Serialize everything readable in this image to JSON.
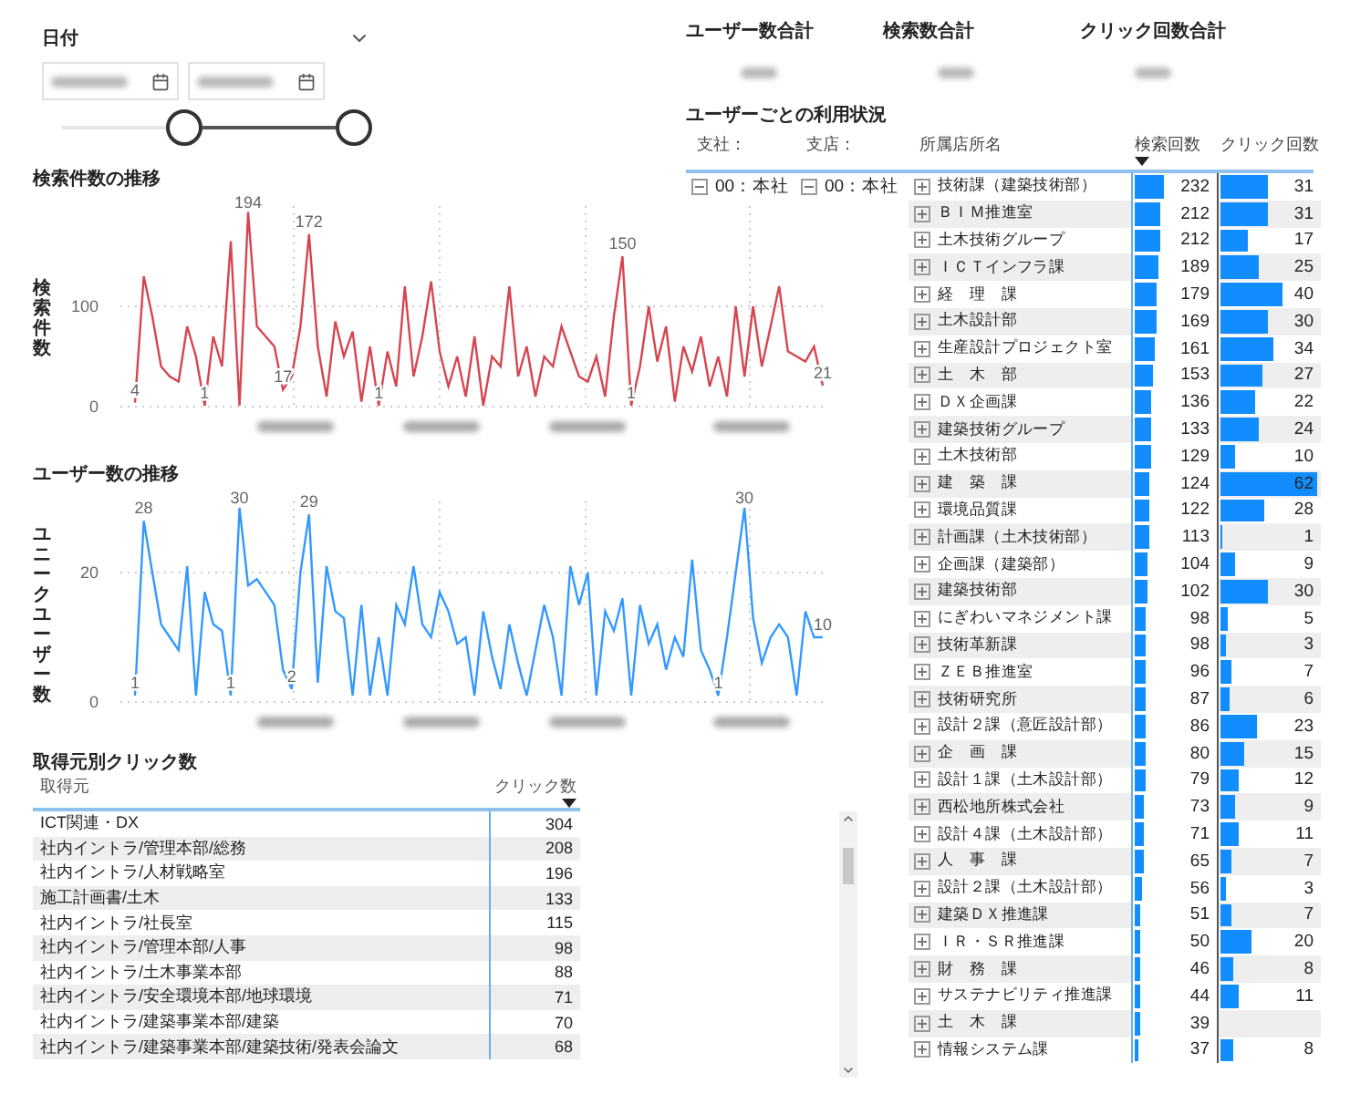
{
  "date_slicer": {
    "title": "日付",
    "handles": [
      {
        "level": 0.42
      },
      {
        "level": 1
      }
    ]
  },
  "search_chart": {
    "title": "検索件数の推移",
    "chart_data": {
      "type": "line",
      "ylabel": "検索件数",
      "ylim": [
        0,
        200
      ],
      "yticks": [
        0,
        100
      ],
      "series": [
        {
          "color": "#d64550",
          "values": [
            4,
            130,
            90,
            40,
            30,
            25,
            80,
            50,
            1,
            70,
            40,
            165,
            1,
            194,
            80,
            70,
            60,
            17,
            30,
            80,
            172,
            60,
            10,
            85,
            50,
            75,
            5,
            60,
            1,
            55,
            20,
            120,
            30,
            70,
            125,
            55,
            20,
            50,
            10,
            70,
            1,
            50,
            40,
            120,
            30,
            60,
            10,
            50,
            40,
            80,
            55,
            30,
            25,
            50,
            10,
            90,
            150,
            1,
            40,
            100,
            45,
            80,
            5,
            60,
            35,
            70,
            20,
            50,
            10,
            100,
            30,
            100,
            40,
            80,
            120,
            55,
            50,
            45,
            60,
            21
          ]
        }
      ],
      "value_labels": [
        "4",
        null,
        null,
        null,
        null,
        null,
        null,
        null,
        "1",
        null,
        null,
        null,
        null,
        "194",
        null,
        null,
        null,
        "17",
        null,
        null,
        "172",
        null,
        null,
        null,
        null,
        null,
        null,
        null,
        "1",
        null,
        null,
        null,
        null,
        null,
        null,
        null,
        null,
        null,
        null,
        null,
        null,
        null,
        null,
        null,
        null,
        null,
        null,
        null,
        null,
        null,
        null,
        null,
        null,
        null,
        null,
        null,
        "150",
        "1",
        null,
        null,
        null,
        null,
        null,
        null,
        null,
        null,
        null,
        null,
        null,
        null,
        null,
        null,
        null,
        null,
        null,
        null,
        null,
        null,
        null,
        "21"
      ]
    }
  },
  "user_chart": {
    "title": "ユーザー数の推移",
    "chart_data": {
      "type": "line",
      "ylabel": "ユニークユーザー数",
      "ylim": [
        0,
        31
      ],
      "yticks": [
        0,
        20
      ],
      "series": [
        {
          "color": "#3399ff",
          "values": [
            1,
            28,
            20,
            12,
            10,
            8,
            21,
            1,
            17,
            12,
            11,
            1,
            30,
            18,
            19,
            17,
            15,
            5,
            2,
            20,
            29,
            3,
            21,
            14,
            13,
            1,
            15,
            1,
            10,
            1,
            15,
            12,
            21,
            12,
            10,
            17,
            14,
            9,
            10,
            1,
            14,
            7,
            2,
            12,
            6,
            1,
            8,
            15,
            10,
            1,
            21,
            15,
            20,
            1,
            14,
            11,
            16,
            1,
            15,
            9,
            12,
            5,
            10,
            7,
            22,
            8,
            5,
            1,
            10,
            20,
            30,
            13,
            6,
            10,
            12,
            10,
            1,
            14,
            10,
            10
          ]
        }
      ],
      "value_labels": [
        "1",
        "28",
        null,
        null,
        null,
        null,
        null,
        null,
        null,
        null,
        null,
        "1",
        "30",
        null,
        null,
        null,
        null,
        null,
        "2",
        null,
        "29",
        null,
        null,
        null,
        null,
        null,
        null,
        null,
        null,
        null,
        null,
        null,
        null,
        null,
        null,
        null,
        null,
        null,
        null,
        null,
        null,
        null,
        null,
        null,
        null,
        null,
        null,
        null,
        null,
        null,
        null,
        null,
        null,
        null,
        null,
        null,
        null,
        null,
        null,
        null,
        null,
        null,
        null,
        null,
        null,
        null,
        null,
        "1",
        null,
        null,
        "30",
        null,
        null,
        null,
        null,
        null,
        null,
        null,
        null,
        "10"
      ]
    }
  },
  "source_table": {
    "title": "取得元別クリック数",
    "columns": [
      "取得元",
      "クリック数"
    ],
    "rows": [
      {
        "source": "ICT関連・DX",
        "clicks": "304"
      },
      {
        "source": "社内イントラ/管理本部/総務",
        "clicks": "208"
      },
      {
        "source": "社内イントラ/人材戦略室",
        "clicks": "196"
      },
      {
        "source": "施工計画書/土木",
        "clicks": "133"
      },
      {
        "source": "社内イントラ/社長室",
        "clicks": "115"
      },
      {
        "source": "社内イントラ/管理本部/人事",
        "clicks": "98"
      },
      {
        "source": "社内イントラ/土木事業本部",
        "clicks": "88"
      },
      {
        "source": "社内イントラ/安全環境本部/地球環境",
        "clicks": "71"
      },
      {
        "source": "社内イントラ/建築事業本部/建築",
        "clicks": "70"
      },
      {
        "source": "社内イントラ/建築事業本部/建築技術/発表会論文",
        "clicks": "68"
      }
    ]
  },
  "kpis": [
    {
      "label": "ユーザー数合計"
    },
    {
      "label": "検索数合計"
    },
    {
      "label": "クリック回数合計"
    }
  ],
  "user_table": {
    "title": "ユーザーごとの利用状況",
    "columns": [
      "支社：",
      "支店：",
      "所属店所名",
      "検索回数",
      "クリック回数"
    ],
    "company": {
      "name": "00：本社",
      "expanded": true
    },
    "branch": {
      "name": "00：本社",
      "expanded": true
    },
    "rows": [
      {
        "name": "技術課（建築技術部）",
        "expanded": false,
        "search": {
          "value": "232",
          "level": 0.34
        },
        "clicks": {
          "value": "31",
          "level": 0.47
        }
      },
      {
        "name": "ＢＩＭ推進室",
        "expanded": false,
        "search": {
          "value": "212",
          "level": 0.31
        },
        "clicks": {
          "value": "31",
          "level": 0.47
        }
      },
      {
        "name": "土木技術グループ",
        "expanded": false,
        "search": {
          "value": "212",
          "level": 0.31
        },
        "clicks": {
          "value": "17",
          "level": 0.26
        }
      },
      {
        "name": "ＩＣＴインフラ課",
        "expanded": false,
        "search": {
          "value": "189",
          "level": 0.28
        },
        "clicks": {
          "value": "25",
          "level": 0.38
        }
      },
      {
        "name": "経　理　課",
        "expanded": false,
        "search": {
          "value": "179",
          "level": 0.26
        },
        "clicks": {
          "value": "40",
          "level": 0.61
        }
      },
      {
        "name": "土木設計部",
        "expanded": false,
        "search": {
          "value": "169",
          "level": 0.25
        },
        "clicks": {
          "value": "30",
          "level": 0.46
        }
      },
      {
        "name": "生産設計プロジェクト室",
        "expanded": false,
        "search": {
          "value": "161",
          "level": 0.24
        },
        "clicks": {
          "value": "34",
          "level": 0.52
        }
      },
      {
        "name": "土　木　部",
        "expanded": false,
        "search": {
          "value": "153",
          "level": 0.22
        },
        "clicks": {
          "value": "27",
          "level": 0.41
        }
      },
      {
        "name": "ＤＸ企画課",
        "expanded": false,
        "search": {
          "value": "136",
          "level": 0.2
        },
        "clicks": {
          "value": "22",
          "level": 0.34
        }
      },
      {
        "name": "建築技術グループ",
        "expanded": false,
        "search": {
          "value": "133",
          "level": 0.2
        },
        "clicks": {
          "value": "24",
          "level": 0.37
        }
      },
      {
        "name": "土木技術部",
        "expanded": false,
        "search": {
          "value": "129",
          "level": 0.19
        },
        "clicks": {
          "value": "10",
          "level": 0.15
        }
      },
      {
        "name": "建　築　課",
        "expanded": false,
        "search": {
          "value": "124",
          "level": 0.18
        },
        "clicks": {
          "value": "62",
          "level": 0.95
        }
      },
      {
        "name": "環境品質課",
        "expanded": false,
        "search": {
          "value": "122",
          "level": 0.18
        },
        "clicks": {
          "value": "28",
          "level": 0.43
        }
      },
      {
        "name": "計画課（土木技術部）",
        "expanded": false,
        "search": {
          "value": "113",
          "level": 0.17
        },
        "clicks": {
          "value": "1",
          "level": 0.02
        }
      },
      {
        "name": "企画課（建築部）",
        "expanded": false,
        "search": {
          "value": "104",
          "level": 0.15
        },
        "clicks": {
          "value": "9",
          "level": 0.14
        }
      },
      {
        "name": "建築技術部",
        "expanded": false,
        "search": {
          "value": "102",
          "level": 0.15
        },
        "clicks": {
          "value": "30",
          "level": 0.46
        }
      },
      {
        "name": "にぎわいマネジメント課",
        "expanded": false,
        "search": {
          "value": "98",
          "level": 0.14
        },
        "clicks": {
          "value": "5",
          "level": 0.08
        }
      },
      {
        "name": "技術革新課",
        "expanded": false,
        "search": {
          "value": "98",
          "level": 0.14
        },
        "clicks": {
          "value": "3",
          "level": 0.05
        }
      },
      {
        "name": "ＺＥＢ推進室",
        "expanded": false,
        "search": {
          "value": "96",
          "level": 0.14
        },
        "clicks": {
          "value": "7",
          "level": 0.11
        }
      },
      {
        "name": "技術研究所",
        "expanded": false,
        "search": {
          "value": "87",
          "level": 0.13
        },
        "clicks": {
          "value": "6",
          "level": 0.09
        }
      },
      {
        "name": "設計２課（意匠設計部）",
        "expanded": false,
        "search": {
          "value": "86",
          "level": 0.13
        },
        "clicks": {
          "value": "23",
          "level": 0.35
        }
      },
      {
        "name": "企　画　課",
        "expanded": false,
        "search": {
          "value": "80",
          "level": 0.12
        },
        "clicks": {
          "value": "15",
          "level": 0.23
        }
      },
      {
        "name": "設計１課（土木設計部）",
        "expanded": false,
        "search": {
          "value": "79",
          "level": 0.12
        },
        "clicks": {
          "value": "12",
          "level": 0.18
        }
      },
      {
        "name": "西松地所株式会社",
        "expanded": false,
        "search": {
          "value": "73",
          "level": 0.11
        },
        "clicks": {
          "value": "9",
          "level": 0.14
        }
      },
      {
        "name": "設計４課（土木設計部）",
        "expanded": false,
        "search": {
          "value": "71",
          "level": 0.1
        },
        "clicks": {
          "value": "11",
          "level": 0.17
        }
      },
      {
        "name": "人　事　課",
        "expanded": false,
        "search": {
          "value": "65",
          "level": 0.1
        },
        "clicks": {
          "value": "7",
          "level": 0.11
        }
      },
      {
        "name": "設計２課（土木設計部）",
        "expanded": false,
        "search": {
          "value": "56",
          "level": 0.08
        },
        "clicks": {
          "value": "3",
          "level": 0.05
        }
      },
      {
        "name": "建築ＤＸ推進課",
        "expanded": false,
        "search": {
          "value": "51",
          "level": 0.07
        },
        "clicks": {
          "value": "7",
          "level": 0.11
        }
      },
      {
        "name": "ＩＲ・ＳＲ推進課",
        "expanded": false,
        "search": {
          "value": "50",
          "level": 0.07
        },
        "clicks": {
          "value": "20",
          "level": 0.31
        }
      },
      {
        "name": "財　務　課",
        "expanded": false,
        "search": {
          "value": "46",
          "level": 0.07
        },
        "clicks": {
          "value": "8",
          "level": 0.12
        }
      },
      {
        "name": "サステナビリティ推進課",
        "expanded": false,
        "search": {
          "value": "44",
          "level": 0.06
        },
        "clicks": {
          "value": "11",
          "level": 0.17
        }
      },
      {
        "name": "土　木　課",
        "expanded": false,
        "search": {
          "value": "39",
          "level": 0.06
        }
      },
      {
        "name": "情報システム課",
        "expanded": false,
        "search": {
          "value": "37",
          "level": 0.05
        },
        "clicks": {
          "value": "8",
          "level": 0.12
        }
      }
    ]
  }
}
